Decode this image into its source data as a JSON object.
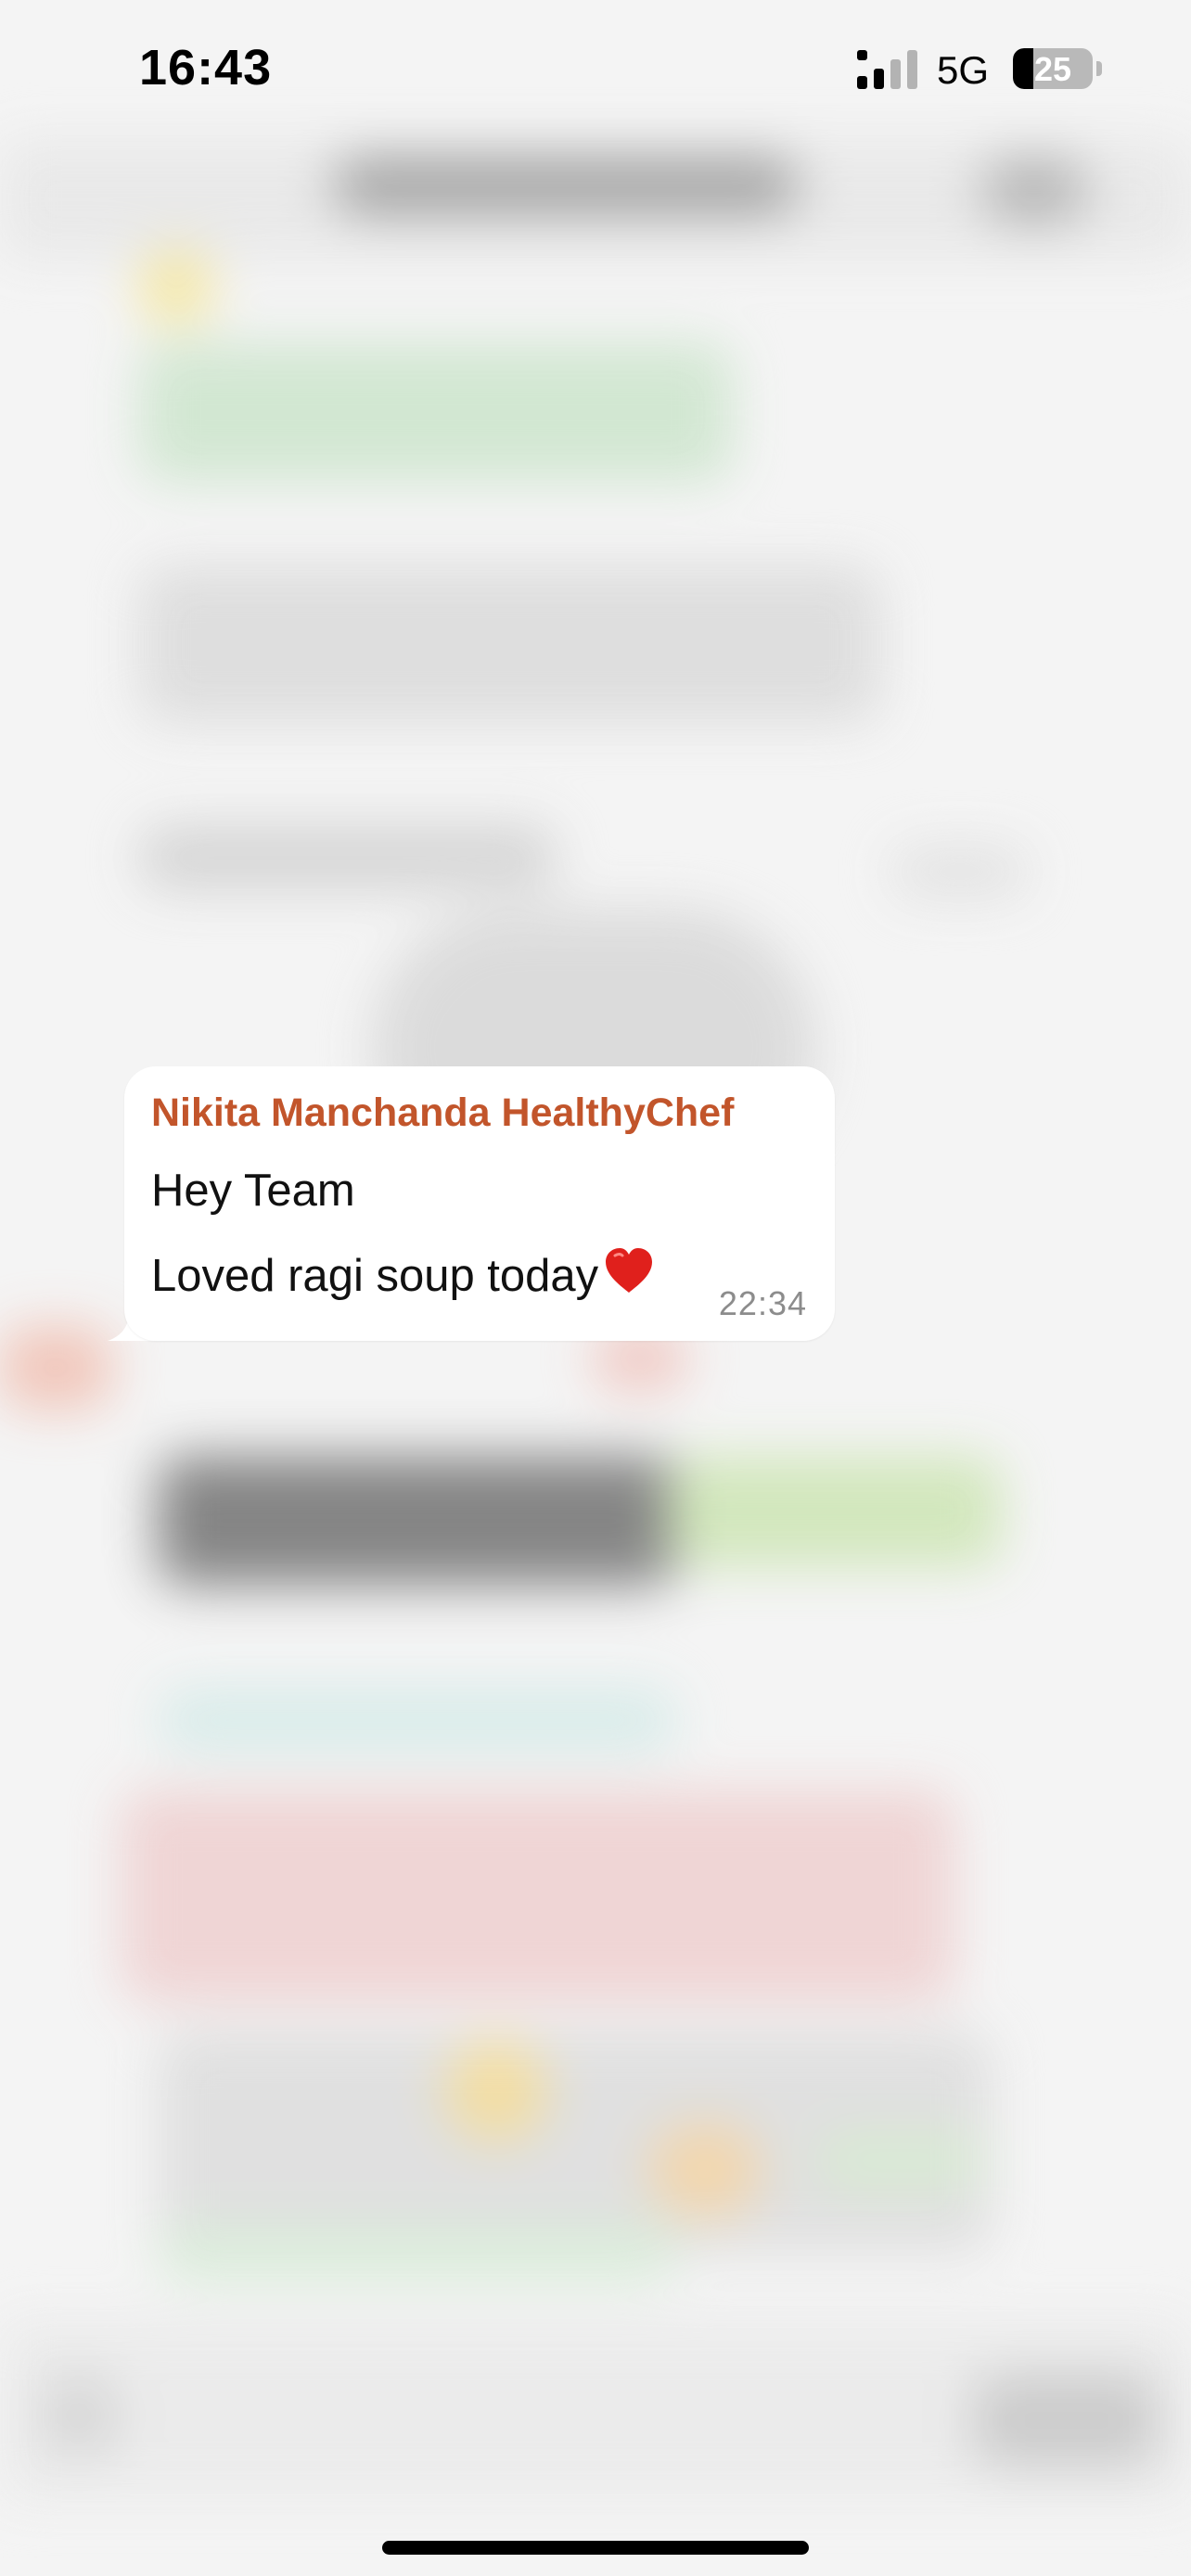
{
  "status_bar": {
    "time": "16:43",
    "network": "5G",
    "battery_level": "25",
    "battery_fraction": 0.25,
    "signal_icon": "cellular-signal-icon"
  },
  "message": {
    "sender": "Nikita Manchanda HealthyChef",
    "sender_color": "#c2552b",
    "lines": [
      "Hey Team",
      "Loved ragi soup today"
    ],
    "emoji_icon": "red-heart-icon",
    "time": "22:34"
  }
}
